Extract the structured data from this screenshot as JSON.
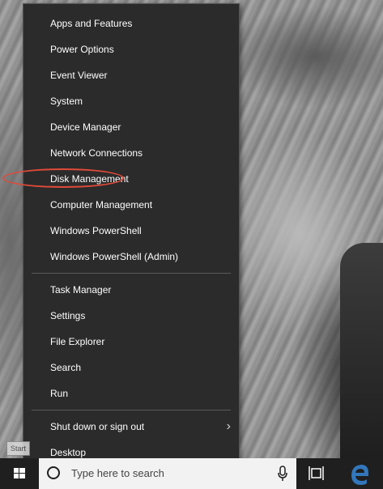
{
  "menu": {
    "group1": [
      {
        "id": "apps-features",
        "label": "Apps and Features"
      },
      {
        "id": "power-options",
        "label": "Power Options"
      },
      {
        "id": "event-viewer",
        "label": "Event Viewer"
      },
      {
        "id": "system",
        "label": "System"
      },
      {
        "id": "device-manager",
        "label": "Device Manager"
      },
      {
        "id": "network-connections",
        "label": "Network Connections"
      },
      {
        "id": "disk-management",
        "label": "Disk Management"
      },
      {
        "id": "computer-management",
        "label": "Computer Management"
      },
      {
        "id": "windows-powershell",
        "label": "Windows PowerShell"
      },
      {
        "id": "windows-powershell-admin",
        "label": "Windows PowerShell (Admin)"
      }
    ],
    "group2": [
      {
        "id": "task-manager",
        "label": "Task Manager"
      },
      {
        "id": "settings",
        "label": "Settings"
      },
      {
        "id": "file-explorer",
        "label": "File Explorer"
      },
      {
        "id": "search",
        "label": "Search"
      },
      {
        "id": "run",
        "label": "Run"
      }
    ],
    "group3": [
      {
        "id": "shut-down",
        "label": "Shut down or sign out",
        "submenu_icon": "chevron-right-icon"
      },
      {
        "id": "desktop",
        "label": "Desktop"
      }
    ],
    "highlighted_item": "Disk Management",
    "highlight_color": "#e04a3a"
  },
  "tooltip": {
    "label": "Start"
  },
  "taskbar": {
    "search": {
      "placeholder": "Type here to search"
    },
    "icons": [
      "windows-logo-icon",
      "cortana-icon",
      "microphone-icon",
      "task-view-icon",
      "edge-icon"
    ]
  },
  "colors": {
    "menu_bg": "#2b2b2b",
    "taskbar_bg": "#1f1f1f",
    "edge_blue": "#3277bc"
  }
}
